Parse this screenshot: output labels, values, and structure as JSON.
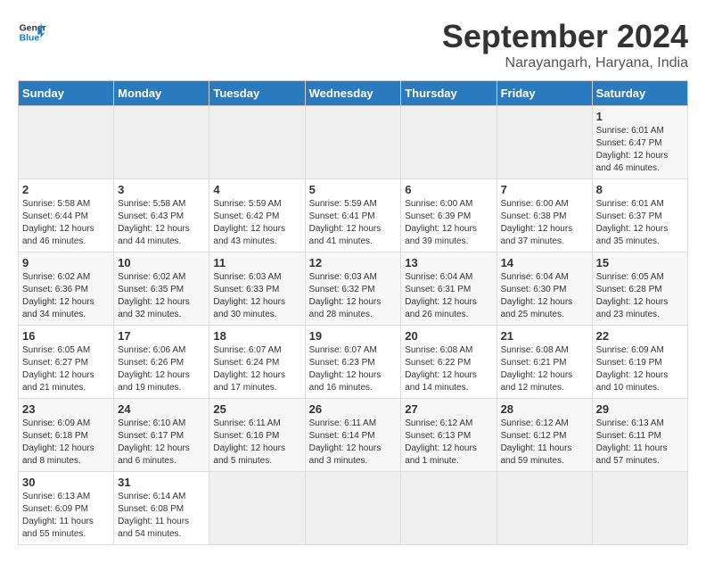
{
  "header": {
    "logo_text_general": "General",
    "logo_text_blue": "Blue",
    "month_year": "September 2024",
    "location": "Narayangarh, Haryana, India"
  },
  "calendar": {
    "days_of_week": [
      "Sunday",
      "Monday",
      "Tuesday",
      "Wednesday",
      "Thursday",
      "Friday",
      "Saturday"
    ],
    "weeks": [
      [
        {
          "day": "",
          "empty": true
        },
        {
          "day": "",
          "empty": true
        },
        {
          "day": "",
          "empty": true
        },
        {
          "day": "",
          "empty": true
        },
        {
          "day": "",
          "empty": true
        },
        {
          "day": "",
          "empty": true
        },
        {
          "day": "1",
          "sunrise": "Sunrise: 6:01 AM",
          "sunset": "Sunset: 6:47 PM",
          "daylight": "Daylight: 12 hours and 46 minutes."
        }
      ],
      [
        {
          "day": "2",
          "sunrise": "Sunrise: 5:58 AM",
          "sunset": "Sunset: 6:44 PM",
          "daylight": "Daylight: 12 hours and 46 minutes."
        },
        {
          "day": "3",
          "sunrise": "Sunrise: 5:58 AM",
          "sunset": "Sunset: 6:43 PM",
          "daylight": "Daylight: 12 hours and 44 minutes."
        },
        {
          "day": "4",
          "sunrise": "Sunrise: 5:59 AM",
          "sunset": "Sunset: 6:42 PM",
          "daylight": "Daylight: 12 hours and 43 minutes."
        },
        {
          "day": "5",
          "sunrise": "Sunrise: 5:59 AM",
          "sunset": "Sunset: 6:41 PM",
          "daylight": "Daylight: 12 hours and 41 minutes."
        },
        {
          "day": "6",
          "sunrise": "Sunrise: 6:00 AM",
          "sunset": "Sunset: 6:39 PM",
          "daylight": "Daylight: 12 hours and 39 minutes."
        },
        {
          "day": "7",
          "sunrise": "Sunrise: 6:00 AM",
          "sunset": "Sunset: 6:38 PM",
          "daylight": "Daylight: 12 hours and 37 minutes."
        },
        {
          "day": "8",
          "sunrise": "Sunrise: 6:01 AM",
          "sunset": "Sunset: 6:37 PM",
          "daylight": "Daylight: 12 hours and 35 minutes."
        }
      ],
      [
        {
          "day": "9",
          "sunrise": "Sunrise: 6:02 AM",
          "sunset": "Sunset: 6:36 PM",
          "daylight": "Daylight: 12 hours and 34 minutes."
        },
        {
          "day": "10",
          "sunrise": "Sunrise: 6:02 AM",
          "sunset": "Sunset: 6:35 PM",
          "daylight": "Daylight: 12 hours and 32 minutes."
        },
        {
          "day": "11",
          "sunrise": "Sunrise: 6:03 AM",
          "sunset": "Sunset: 6:33 PM",
          "daylight": "Daylight: 12 hours and 30 minutes."
        },
        {
          "day": "12",
          "sunrise": "Sunrise: 6:03 AM",
          "sunset": "Sunset: 6:32 PM",
          "daylight": "Daylight: 12 hours and 28 minutes."
        },
        {
          "day": "13",
          "sunrise": "Sunrise: 6:04 AM",
          "sunset": "Sunset: 6:31 PM",
          "daylight": "Daylight: 12 hours and 26 minutes."
        },
        {
          "day": "14",
          "sunrise": "Sunrise: 6:04 AM",
          "sunset": "Sunset: 6:30 PM",
          "daylight": "Daylight: 12 hours and 25 minutes."
        },
        {
          "day": "15",
          "sunrise": "Sunrise: 6:05 AM",
          "sunset": "Sunset: 6:28 PM",
          "daylight": "Daylight: 12 hours and 23 minutes."
        }
      ],
      [
        {
          "day": "16",
          "sunrise": "Sunrise: 6:05 AM",
          "sunset": "Sunset: 6:27 PM",
          "daylight": "Daylight: 12 hours and 21 minutes."
        },
        {
          "day": "17",
          "sunrise": "Sunrise: 6:06 AM",
          "sunset": "Sunset: 6:26 PM",
          "daylight": "Daylight: 12 hours and 19 minutes."
        },
        {
          "day": "18",
          "sunrise": "Sunrise: 6:07 AM",
          "sunset": "Sunset: 6:24 PM",
          "daylight": "Daylight: 12 hours and 17 minutes."
        },
        {
          "day": "19",
          "sunrise": "Sunrise: 6:07 AM",
          "sunset": "Sunset: 6:23 PM",
          "daylight": "Daylight: 12 hours and 16 minutes."
        },
        {
          "day": "20",
          "sunrise": "Sunrise: 6:08 AM",
          "sunset": "Sunset: 6:22 PM",
          "daylight": "Daylight: 12 hours and 14 minutes."
        },
        {
          "day": "21",
          "sunrise": "Sunrise: 6:08 AM",
          "sunset": "Sunset: 6:21 PM",
          "daylight": "Daylight: 12 hours and 12 minutes."
        },
        {
          "day": "22",
          "sunrise": "Sunrise: 6:09 AM",
          "sunset": "Sunset: 6:19 PM",
          "daylight": "Daylight: 12 hours and 10 minutes."
        }
      ],
      [
        {
          "day": "23",
          "sunrise": "Sunrise: 6:09 AM",
          "sunset": "Sunset: 6:18 PM",
          "daylight": "Daylight: 12 hours and 8 minutes."
        },
        {
          "day": "24",
          "sunrise": "Sunrise: 6:10 AM",
          "sunset": "Sunset: 6:17 PM",
          "daylight": "Daylight: 12 hours and 6 minutes."
        },
        {
          "day": "25",
          "sunrise": "Sunrise: 6:11 AM",
          "sunset": "Sunset: 6:16 PM",
          "daylight": "Daylight: 12 hours and 5 minutes."
        },
        {
          "day": "26",
          "sunrise": "Sunrise: 6:11 AM",
          "sunset": "Sunset: 6:14 PM",
          "daylight": "Daylight: 12 hours and 3 minutes."
        },
        {
          "day": "27",
          "sunrise": "Sunrise: 6:12 AM",
          "sunset": "Sunset: 6:13 PM",
          "daylight": "Daylight: 12 hours and 1 minute."
        },
        {
          "day": "28",
          "sunrise": "Sunrise: 6:12 AM",
          "sunset": "Sunset: 6:12 PM",
          "daylight": "Daylight: 11 hours and 59 minutes."
        },
        {
          "day": "29",
          "sunrise": "Sunrise: 6:13 AM",
          "sunset": "Sunset: 6:11 PM",
          "daylight": "Daylight: 11 hours and 57 minutes."
        }
      ],
      [
        {
          "day": "30",
          "sunrise": "Sunrise: 6:13 AM",
          "sunset": "Sunset: 6:09 PM",
          "daylight": "Daylight: 11 hours and 55 minutes."
        },
        {
          "day": "31",
          "sunrise": "Sunrise: 6:14 AM",
          "sunset": "Sunset: 6:08 PM",
          "daylight": "Daylight: 11 hours and 54 minutes."
        },
        {
          "day": "",
          "empty": true
        },
        {
          "day": "",
          "empty": true
        },
        {
          "day": "",
          "empty": true
        },
        {
          "day": "",
          "empty": true
        },
        {
          "day": "",
          "empty": true
        }
      ]
    ]
  }
}
